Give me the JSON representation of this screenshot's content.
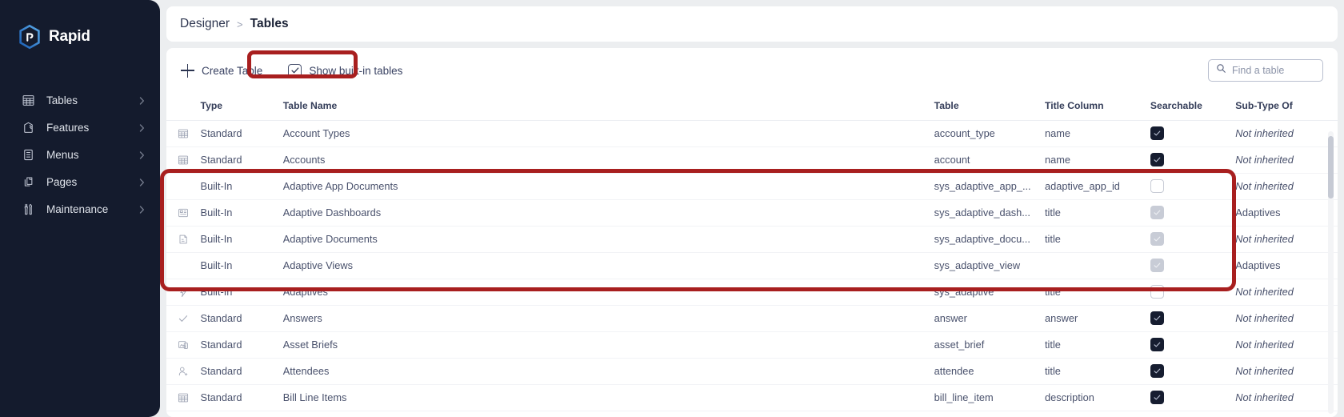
{
  "brand": {
    "name": "Rapid",
    "logo_icon": "rapid-hexagon-logo"
  },
  "sidebar": {
    "items": [
      {
        "label": "Tables",
        "icon": "table-grid-icon"
      },
      {
        "label": "Features",
        "icon": "features-flag-icon"
      },
      {
        "label": "Menus",
        "icon": "menu-list-icon"
      },
      {
        "label": "Pages",
        "icon": "pages-stack-icon"
      },
      {
        "label": "Maintenance",
        "icon": "maintenance-tools-icon"
      }
    ],
    "chevron_icon": "chevron-right-icon"
  },
  "breadcrumb": {
    "parent": "Designer",
    "separator": ">",
    "current": "Tables"
  },
  "toolbar": {
    "create_table_label": "Create Table",
    "create_table_icon": "plus-icon",
    "show_builtin_label": "Show built-in tables",
    "show_builtin_checked": true,
    "check_icon": "check-icon"
  },
  "search": {
    "placeholder": "Find a table",
    "value": "",
    "icon": "search-icon"
  },
  "table": {
    "columns": [
      {
        "key": "icon",
        "label": ""
      },
      {
        "key": "type",
        "label": "Type"
      },
      {
        "key": "name",
        "label": "Table Name"
      },
      {
        "key": "table",
        "label": "Table"
      },
      {
        "key": "title",
        "label": "Title Column"
      },
      {
        "key": "searchable",
        "label": "Searchable"
      },
      {
        "key": "subtype",
        "label": "Sub-Type Of"
      }
    ],
    "subtype_none_text": "Not inherited",
    "rows": [
      {
        "icon": "table-grid-icon",
        "type": "Standard",
        "name": "Account Types",
        "table": "account_type",
        "title": "name",
        "searchable": "checked",
        "subtype": "Not inherited",
        "subtype_inherited": false,
        "highlighted": false
      },
      {
        "icon": "table-grid-icon",
        "type": "Standard",
        "name": "Accounts",
        "table": "account",
        "title": "name",
        "searchable": "checked",
        "subtype": "Not inherited",
        "subtype_inherited": false,
        "highlighted": false
      },
      {
        "icon": "",
        "type": "Built-In",
        "name": "Adaptive App Documents",
        "table": "sys_adaptive_app_...",
        "title": "adaptive_app_id",
        "searchable": "empty",
        "subtype": "Not inherited",
        "subtype_inherited": false,
        "highlighted": true
      },
      {
        "icon": "dashboard-icon",
        "type": "Built-In",
        "name": "Adaptive Dashboards",
        "table": "sys_adaptive_dash...",
        "title": "title",
        "searchable": "disabled",
        "subtype": "Adaptives",
        "subtype_inherited": true,
        "highlighted": true
      },
      {
        "icon": "document-icon",
        "type": "Built-In",
        "name": "Adaptive Documents",
        "table": "sys_adaptive_docu...",
        "title": "title",
        "searchable": "disabled",
        "subtype": "Not inherited",
        "subtype_inherited": false,
        "highlighted": true
      },
      {
        "icon": "",
        "type": "Built-In",
        "name": "Adaptive Views",
        "table": "sys_adaptive_view",
        "title": "",
        "searchable": "disabled",
        "subtype": "Adaptives",
        "subtype_inherited": true,
        "highlighted": true
      },
      {
        "icon": "lightning-icon",
        "type": "Built-In",
        "name": "Adaptives",
        "table": "sys_adaptive",
        "title": "title",
        "searchable": "empty",
        "subtype": "Not inherited",
        "subtype_inherited": false,
        "highlighted": true
      },
      {
        "icon": "check-icon",
        "type": "Standard",
        "name": "Answers",
        "table": "answer",
        "title": "answer",
        "searchable": "checked",
        "subtype": "Not inherited",
        "subtype_inherited": false,
        "highlighted": false
      },
      {
        "icon": "image-icon",
        "type": "Standard",
        "name": "Asset Briefs",
        "table": "asset_brief",
        "title": "title",
        "searchable": "checked",
        "subtype": "Not inherited",
        "subtype_inherited": false,
        "highlighted": false
      },
      {
        "icon": "person-add-icon",
        "type": "Standard",
        "name": "Attendees",
        "table": "attendee",
        "title": "title",
        "searchable": "checked",
        "subtype": "Not inherited",
        "subtype_inherited": false,
        "highlighted": false
      },
      {
        "icon": "table-grid-icon",
        "type": "Standard",
        "name": "Bill Line Items",
        "table": "bill_line_item",
        "title": "description",
        "searchable": "checked",
        "subtype": "Not inherited",
        "subtype_inherited": false,
        "highlighted": false
      }
    ]
  },
  "annotations": [
    {
      "name": "show-builtin-tables-highlight",
      "color": "#a81f1f"
    },
    {
      "name": "builtin-rows-highlight",
      "color": "#a81f1f"
    }
  ]
}
